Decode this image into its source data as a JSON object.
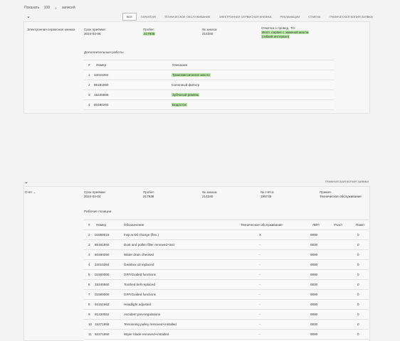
{
  "topbar": {
    "show_label": "Показать",
    "count": "100",
    "records": "записей"
  },
  "tabs": [
    {
      "label": "ВСЕ",
      "active": true
    },
    {
      "label": "ГАРАНТИЯ",
      "active": false
    },
    {
      "label": "ТЕХНИЧЕСКОЕ ОБСЛУЖИВАНИЕ",
      "active": false
    },
    {
      "label": "ЭЛЕКТРОННАЯ СЕРВИСНАЯ КНИЖКА",
      "active": false
    },
    {
      "label": "РЕКЛАМАЦИИ",
      "active": false
    },
    {
      "label": "ОТМЕНА",
      "active": false
    },
    {
      "label": "ГРАФИЧЕСКАЯ КОПИЯ ЗАЯВКИ",
      "active": false
    }
  ],
  "card1": {
    "type": "Электронная сервисная книжка",
    "date_label": "Срок приёмки:",
    "date_value": "2024-03-06",
    "mileage_label": "Пробег:",
    "mileage_value": "217935",
    "order_label": "№ заказа:",
    "order_value": "214340",
    "note_label": "Отметка о провед. ТО:",
    "note_line1": "Инсп. сервис с заменой масла",
    "note_line2": "(гибкий интервал)",
    "extra_title": "Дополнительные работы",
    "table_headers": {
      "num": "#",
      "number": "Номер",
      "desc": "Описание"
    },
    "rows": [
      {
        "num": "1",
        "number": "34015364",
        "desc": "Трансмиссионное масло"
      },
      {
        "num": "2",
        "number": "85181950",
        "desc": "Салонный фильтр"
      },
      {
        "num": "3",
        "number": "15245866",
        "desc": "Зубчатый ремень"
      },
      {
        "num": "4",
        "number": "60480260",
        "desc": "Водосток"
      }
    ]
  },
  "card2": {
    "header_link": "ГРАФИЧЕСКАЯ КОПИЯ ЗАЯВКИ",
    "status": "Счёт",
    "date_label": "Срок приёмки:",
    "date_value": "2024-03-04",
    "mileage_label": "Пробег:",
    "mileage_value": "217938",
    "order_label": "№ заказа:",
    "order_value": "214340",
    "invoice_label": "№ счёта:",
    "invoice_value": "195745",
    "note_label": "Примеч.",
    "note_value": "Техническое обслуживание",
    "work_title": "Рабочие позиции",
    "table_headers": {
      "num": "#",
      "number": "Номер",
      "desc": "Обозначение",
      "service": "Техническое обслуживание",
      "lip": "ЛИП",
      "ucha": "Участ",
      "pack": "Пакет"
    },
    "rows": [
      {
        "num": "2",
        "number": "01889015",
        "desc": "Insp.w.Oil change (flex.)",
        "service": "X",
        "lip": "0000",
        "pack": "0"
      },
      {
        "num": "3",
        "number": "85181950",
        "desc": "Dust and pollen filter removed+inst",
        "service": "-",
        "lip": "0000",
        "pack": "0"
      },
      {
        "num": "3",
        "number": "60480260",
        "desc": "Water drain checked",
        "service": "-",
        "lip": "0000",
        "pack": "0"
      },
      {
        "num": "4",
        "number": "34015364",
        "desc": "Gearbox oil replaced",
        "service": "-",
        "lip": "0000",
        "pack": "0"
      },
      {
        "num": "5",
        "number": "01500000",
        "desc": "GFF/Guided functions",
        "service": "-",
        "lip": "0000",
        "pack": "0"
      },
      {
        "num": "6",
        "number": "15245560",
        "desc": "Toothed belt replaced",
        "service": "-",
        "lip": "0000",
        "pack": "0"
      },
      {
        "num": "7",
        "number": "01500000",
        "desc": "GFF/Guided functions",
        "service": "-",
        "lip": "0000",
        "pack": "0"
      },
      {
        "num": "8",
        "number": "94151663",
        "desc": "Headlight adjusted",
        "service": "-",
        "lip": "0000",
        "pack": "0"
      },
      {
        "num": "9",
        "number": "91330052",
        "desc": "Accident prev.regulations",
        "service": "-",
        "lip": "0000",
        "pack": "0"
      },
      {
        "num": "10",
        "number": "15271955",
        "desc": "Tensioning pulley removed+installed",
        "service": "-",
        "lip": "0000",
        "pack": "0"
      },
      {
        "num": "11",
        "number": "92271950",
        "desc": "Wiper blade removed+installed",
        "service": "-",
        "lip": "0000",
        "pack": "0"
      }
    ]
  }
}
